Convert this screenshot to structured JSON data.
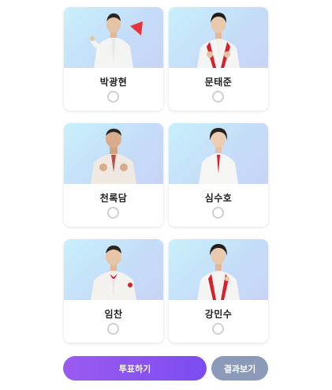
{
  "candidates": [
    {
      "name": "박광현",
      "selected": false,
      "accent": "#e8313a"
    },
    {
      "name": "문태준",
      "selected": false,
      "accent": "#e8313a"
    },
    {
      "name": "천록담",
      "selected": false,
      "accent": "#c8443a"
    },
    {
      "name": "심수호",
      "selected": false,
      "accent": "#e8313a"
    },
    {
      "name": "임찬",
      "selected": false,
      "accent": "#e8313a"
    },
    {
      "name": "강민수",
      "selected": false,
      "accent": "#e8313a"
    }
  ],
  "buttons": {
    "vote_label": "투표하기",
    "result_label": "결과보기"
  },
  "colors": {
    "vote_button": "#8a55f0",
    "result_button": "#8a9ab8",
    "photo_background": "#c5e6fa",
    "radio_border": "#cfcfcf"
  }
}
